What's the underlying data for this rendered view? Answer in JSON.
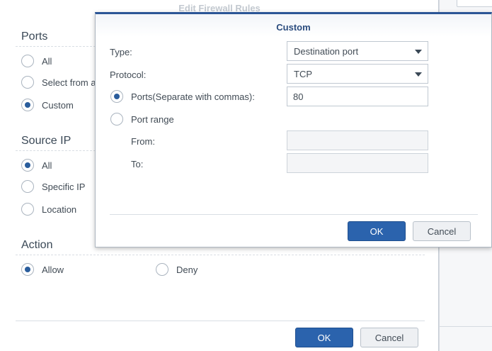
{
  "outer": {
    "title": "Edit Firewall Rules",
    "ports": {
      "title": "Ports",
      "options": [
        {
          "label": "All",
          "checked": false
        },
        {
          "label": "Select from a",
          "checked": false
        },
        {
          "label": "Custom",
          "checked": true
        }
      ]
    },
    "source_ip": {
      "title": "Source IP",
      "options": [
        {
          "label": "All",
          "checked": true
        },
        {
          "label": "Specific IP",
          "checked": false
        },
        {
          "label": "Location",
          "checked": false
        }
      ]
    },
    "action": {
      "title": "Action",
      "options": [
        {
          "label": "Allow",
          "checked": true
        },
        {
          "label": "Deny",
          "checked": false
        }
      ]
    },
    "ok_label": "OK",
    "cancel_label": "Cancel"
  },
  "custom": {
    "title": "Custom",
    "type_label": "Type:",
    "type_value": "Destination port",
    "protocol_label": "Protocol:",
    "protocol_value": "TCP",
    "ports_label": "Ports(Separate with commas):",
    "ports_checked": true,
    "ports_value": "80",
    "range_label": "Port range",
    "range_checked": false,
    "from_label": "From:",
    "from_value": "",
    "to_label": "To:",
    "to_value": "",
    "ok_label": "OK",
    "cancel_label": "Cancel"
  },
  "colors": {
    "accent": "#2b63ad",
    "header_border": "#2b5596",
    "radio_fill": "#2a5d9c"
  }
}
